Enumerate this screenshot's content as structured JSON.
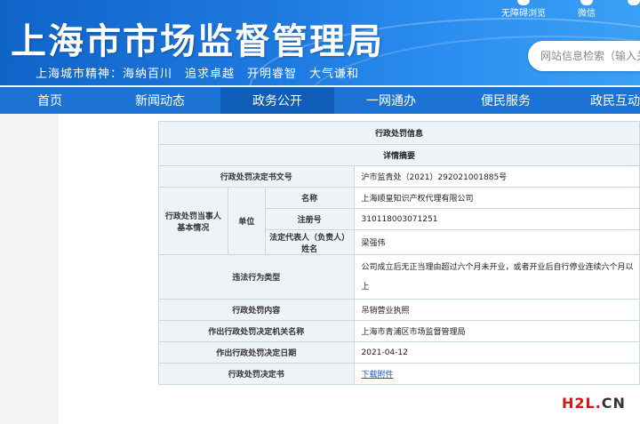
{
  "header": {
    "site_title": "上海市市场监督管理局",
    "spirit": "上海城市精神：海纳百川　追求卓越　开明睿智　大气谦和",
    "top_links": [
      {
        "label": "无障碍浏览",
        "icon": "accessibility-icon"
      },
      {
        "label": "微信",
        "icon": "wechat-icon"
      },
      {
        "label": "",
        "icon": "weibo-icon"
      }
    ],
    "search_placeholder": "网站信息检索（输入关"
  },
  "nav": {
    "items": [
      {
        "label": "首页",
        "active": false
      },
      {
        "label": "新闻动态",
        "active": false
      },
      {
        "label": "政务公开",
        "active": true
      },
      {
        "label": "一网通办",
        "active": false
      },
      {
        "label": "便民服务",
        "active": false
      },
      {
        "label": "政民互动",
        "active": false
      }
    ]
  },
  "record": {
    "title": "行政处罚信息",
    "subtitle": "详情摘要",
    "doc_no_label": "行政处罚决定书文号",
    "doc_no": "沪市监青处（2021）292021001885号",
    "party_label": "行政处罚当事人基本情况",
    "unit_label": "单位",
    "name_label": "名称",
    "name": "上海顺皇知识产权代理有限公司",
    "reg_label": "注册号",
    "reg": "310118003071251",
    "rep_label": "法定代表人（负责人）姓名",
    "rep": "梁强伟",
    "violation_label": "违法行为类型",
    "violation": "公司成立后无正当理由超过六个月未开业，或者开业后自行停业连续六个月以上",
    "content_label": "行政处罚内容",
    "content": "吊销营业执照",
    "authority_label": "作出行政处罚决定机关名称",
    "authority": "上海市青浦区市场监督管理局",
    "date_label": "作出行政处罚决定日期",
    "date": "2021-04-12",
    "decision_label": "行政处罚决定书",
    "decision_link": "下载附件"
  },
  "watermark": {
    "h2l": "H2L",
    "dot": ".",
    "cn": "CN"
  },
  "colors": {
    "brand": "#1d73d3",
    "nav_active": "#0f5db8",
    "table_label_bg": "#eef3f8",
    "link": "#1a55c8"
  }
}
